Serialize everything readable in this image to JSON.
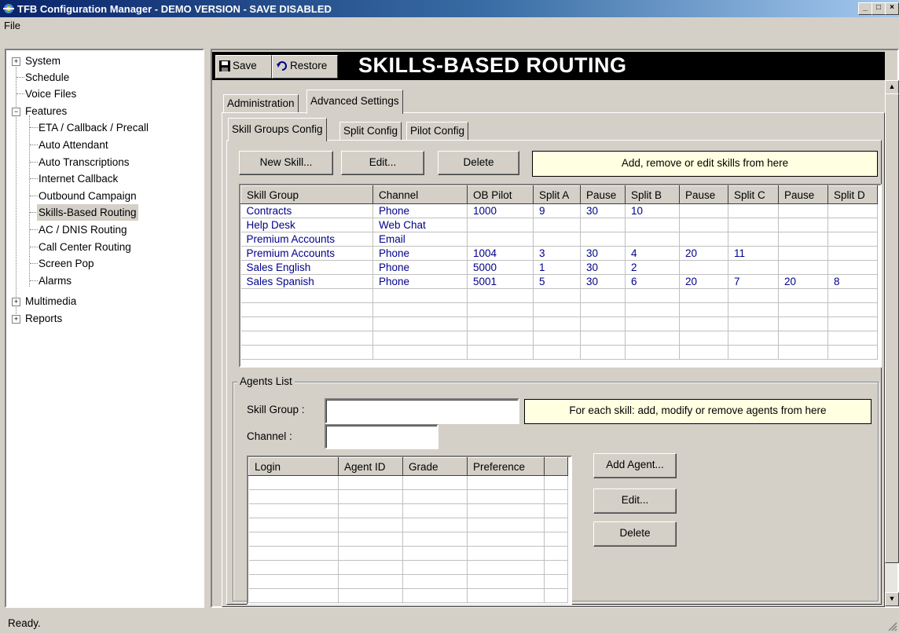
{
  "window": {
    "title": "TFB Configuration Manager - DEMO VERSION - SAVE DISABLED",
    "controls": [
      "_",
      "□",
      "×"
    ]
  },
  "menu": {
    "file": "File"
  },
  "tree": {
    "system": "System",
    "schedule": "Schedule",
    "voice_files": "Voice Files",
    "features": "Features",
    "features_children": [
      "ETA / Callback / Precall",
      "Auto Attendant",
      "Auto Transcriptions",
      "Internet Callback",
      "Outbound Campaign",
      "Skills-Based Routing",
      "AC / DNIS Routing",
      "Call Center Routing",
      "Screen Pop",
      "Alarms"
    ],
    "multimedia": "Multimedia",
    "reports": "Reports",
    "selected": "Skills-Based Routing",
    "expand_plus": "+",
    "expand_minus": "−"
  },
  "toolbar": {
    "save_label": "Save",
    "restore_label": "Restore",
    "page_title": "SKILLS-BASED ROUTING"
  },
  "tabs_top": [
    "Administration",
    "Advanced Settings"
  ],
  "tabs_sub": [
    "Skill Groups Config",
    "Split Config",
    "Pilot Config"
  ],
  "skills": {
    "new_label": "New Skill...",
    "edit_label": "Edit...",
    "delete_label": "Delete",
    "hint": "Add, remove or edit skills from here",
    "columns": [
      "Skill Group",
      "Channel",
      "OB Pilot",
      "Split A",
      "Pause",
      "Split B",
      "Pause",
      "Split C",
      "Pause",
      "Split D"
    ],
    "rows": [
      [
        "Contracts",
        "Phone",
        "1000",
        "9",
        "30",
        "10",
        "",
        "",
        "",
        ""
      ],
      [
        "Help Desk",
        "Web Chat",
        "",
        "",
        "",
        "",
        "",
        "",
        "",
        ""
      ],
      [
        "Premium Accounts",
        "Email",
        "",
        "",
        "",
        "",
        "",
        "",
        "",
        ""
      ],
      [
        "Premium Accounts",
        "Phone",
        "1004",
        "3",
        "30",
        "4",
        "20",
        "11",
        "",
        ""
      ],
      [
        "Sales English",
        "Phone",
        "5000",
        "1",
        "30",
        "2",
        "",
        "",
        "",
        ""
      ],
      [
        "Sales Spanish",
        "Phone",
        "5001",
        "5",
        "30",
        "6",
        "20",
        "7",
        "20",
        "8"
      ]
    ]
  },
  "agents": {
    "group_label": "Agents List",
    "skill_group_label": "Skill Group :",
    "skill_group_value": "",
    "channel_label": "Channel :",
    "channel_value": "",
    "hint": "For each skill: add, modify or remove agents from here",
    "columns": [
      "Login",
      "Agent ID",
      "Grade",
      "Preference"
    ],
    "add_label": "Add Agent...",
    "edit_label": "Edit...",
    "delete_label": "Delete"
  },
  "status": {
    "text": "Ready."
  }
}
